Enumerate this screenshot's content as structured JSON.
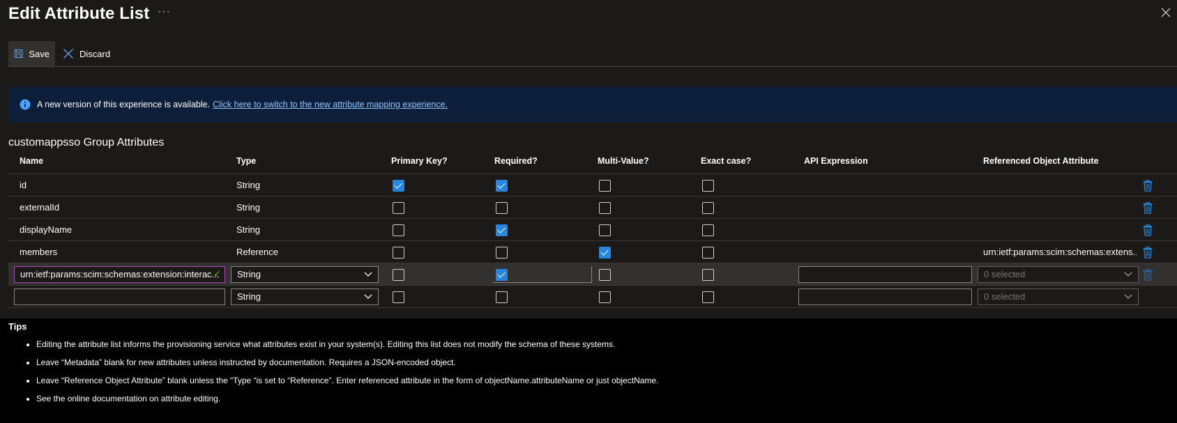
{
  "header": {
    "title": "Edit Attribute List",
    "more": "···"
  },
  "toolbar": {
    "save_label": "Save",
    "discard_label": "Discard"
  },
  "banner": {
    "text": "A new version of this experience is available.",
    "link": "Click here to switch to the new attribute mapping experience."
  },
  "section": {
    "title": "customappsso Group Attributes"
  },
  "table": {
    "headers": {
      "name": "Name",
      "type": "Type",
      "primary_key": "Primary Key?",
      "required": "Required?",
      "multi_value": "Multi-Value?",
      "exact_case": "Exact case?",
      "api_expression": "API Expression",
      "referenced": "Referenced Object Attribute"
    },
    "rows": [
      {
        "name": "id",
        "type": "String",
        "primary_key": true,
        "required": true,
        "multi_value": false,
        "exact_case": false,
        "referenced": ""
      },
      {
        "name": "externalId",
        "type": "String",
        "primary_key": false,
        "required": false,
        "multi_value": false,
        "exact_case": false,
        "referenced": ""
      },
      {
        "name": "displayName",
        "type": "String",
        "primary_key": false,
        "required": true,
        "multi_value": false,
        "exact_case": false,
        "referenced": ""
      },
      {
        "name": "members",
        "type": "Reference",
        "primary_key": false,
        "required": false,
        "multi_value": true,
        "exact_case": false,
        "referenced": "urn:ietf:params:scim:schemas:extens..."
      }
    ],
    "edit_row": {
      "name_value": "urn:ietf:params:scim:schemas:extension:interac...",
      "type_value": "String",
      "required": true,
      "referenced_value": "0 selected"
    },
    "new_row": {
      "name_value": "",
      "type_value": "String",
      "referenced_value": "0 selected"
    }
  },
  "tips": {
    "title": "Tips",
    "items": [
      "Editing the attribute list informs the provisioning service what attributes exist in your system(s). Editing this list does not modify the schema of these systems.",
      "Leave “Metadata” blank for new attributes unless instructed by documentation. Requires a JSON-encoded object.",
      "Leave “Reference Object Attribute” blank unless the “Type “is set to “Reference”. Enter referenced attribute in the form of objectName.attributeName or just objectName.",
      "See the online documentation on attribute editing."
    ]
  },
  "colors": {
    "background": "#1b1a19",
    "banner": "#0c1e3a",
    "link": "#8fc6ff",
    "checkbox": "#2886de",
    "trash": "#2886de",
    "focus": "#b146c2"
  }
}
